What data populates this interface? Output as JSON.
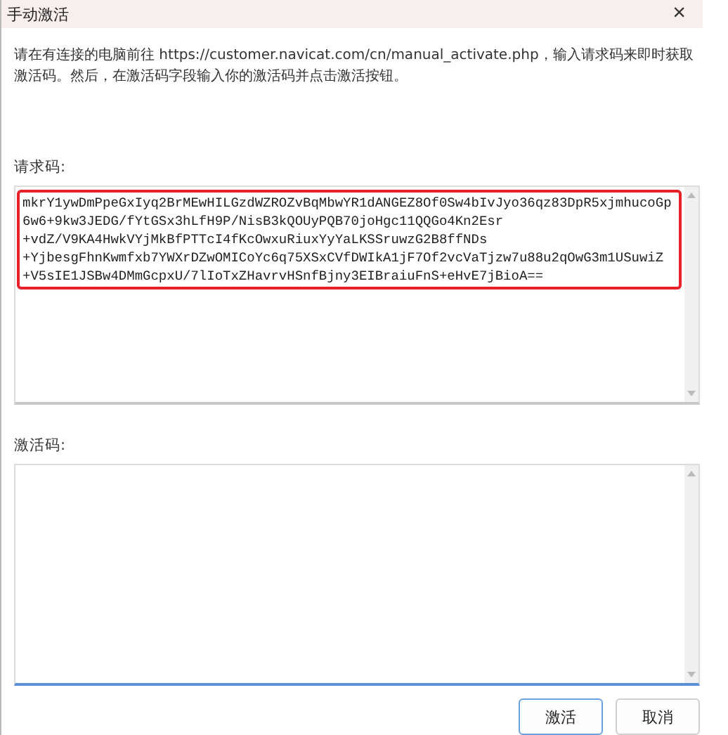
{
  "window": {
    "title": "手动激活",
    "close": "×"
  },
  "instructions": "请在有连接的电脑前往 https://customer.navicat.com/cn/manual_activate.php，输入请求码来即时获取激活码。然后，在激活码字段输入你的激活码并点击激活按钮。",
  "request_code": {
    "label": "请求码:",
    "highlighted": true,
    "lines": [
      "mkrY1ywDmPpeGxIyq2BrMEwHILGzdWZROZvBqMbwYR1dANGEZ8Of0Sw4bIvJyo36qz83DpR5xjmhucoGp",
      "6w6+9kw3JEDG/fYtGSx3hLfH9P/NisB3kQOUyPQB70joHgc11QQGo4Kn2Esr",
      "+vdZ/V9KA4HwkVYjMkBfPTTcI4fKcOwxuRiuxYyYaLKSSruwzG2B8ffNDs",
      "+YjbesgFhnKwmfxb7YWXrDZwOMICoYc6q75XSxCVfDWIkA1jF7Of2vcVaTjzw7u88u2qOwG3m1USuwiZ",
      "+V5sIE1JSBw4DMmGcpxU/7lIoTxZHavrvHSnfBjny3EIBraiuFnS+eHvE7jBioA=="
    ]
  },
  "activation_code": {
    "label": "激活码:",
    "focused": true
  },
  "buttons": [
    {
      "label": "激活",
      "default": true
    },
    {
      "label": "取消",
      "default": false
    }
  ]
}
